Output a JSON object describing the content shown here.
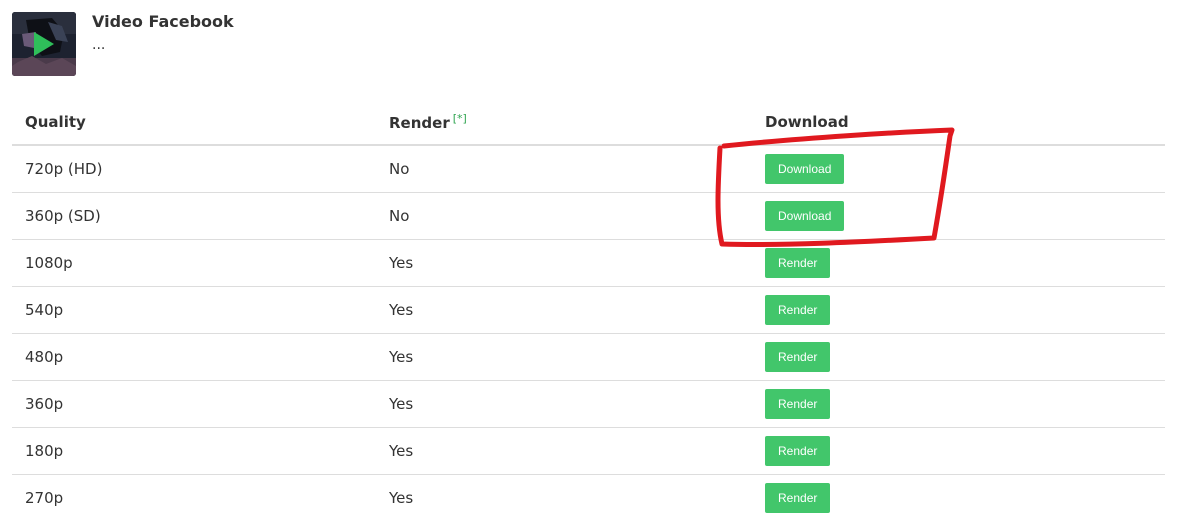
{
  "video": {
    "title": "Video Facebook",
    "description": "..."
  },
  "table": {
    "headers": {
      "quality": "Quality",
      "render": "Render",
      "render_note": "[*]",
      "download": "Download"
    },
    "rows": [
      {
        "quality": "720p (HD)",
        "render": "No",
        "action": "Download"
      },
      {
        "quality": "360p (SD)",
        "render": "No",
        "action": "Download"
      },
      {
        "quality": "1080p",
        "render": "Yes",
        "action": "Render"
      },
      {
        "quality": "540p",
        "render": "Yes",
        "action": "Render"
      },
      {
        "quality": "480p",
        "render": "Yes",
        "action": "Render"
      },
      {
        "quality": "360p",
        "render": "Yes",
        "action": "Render"
      },
      {
        "quality": "180p",
        "render": "Yes",
        "action": "Render"
      },
      {
        "quality": "270p",
        "render": "Yes",
        "action": "Render"
      }
    ]
  },
  "colors": {
    "button": "#42c66b",
    "note": "#2ea44f",
    "annotation": "#e0191f"
  },
  "icons": {
    "thumbnail_overlay": "play-icon"
  }
}
